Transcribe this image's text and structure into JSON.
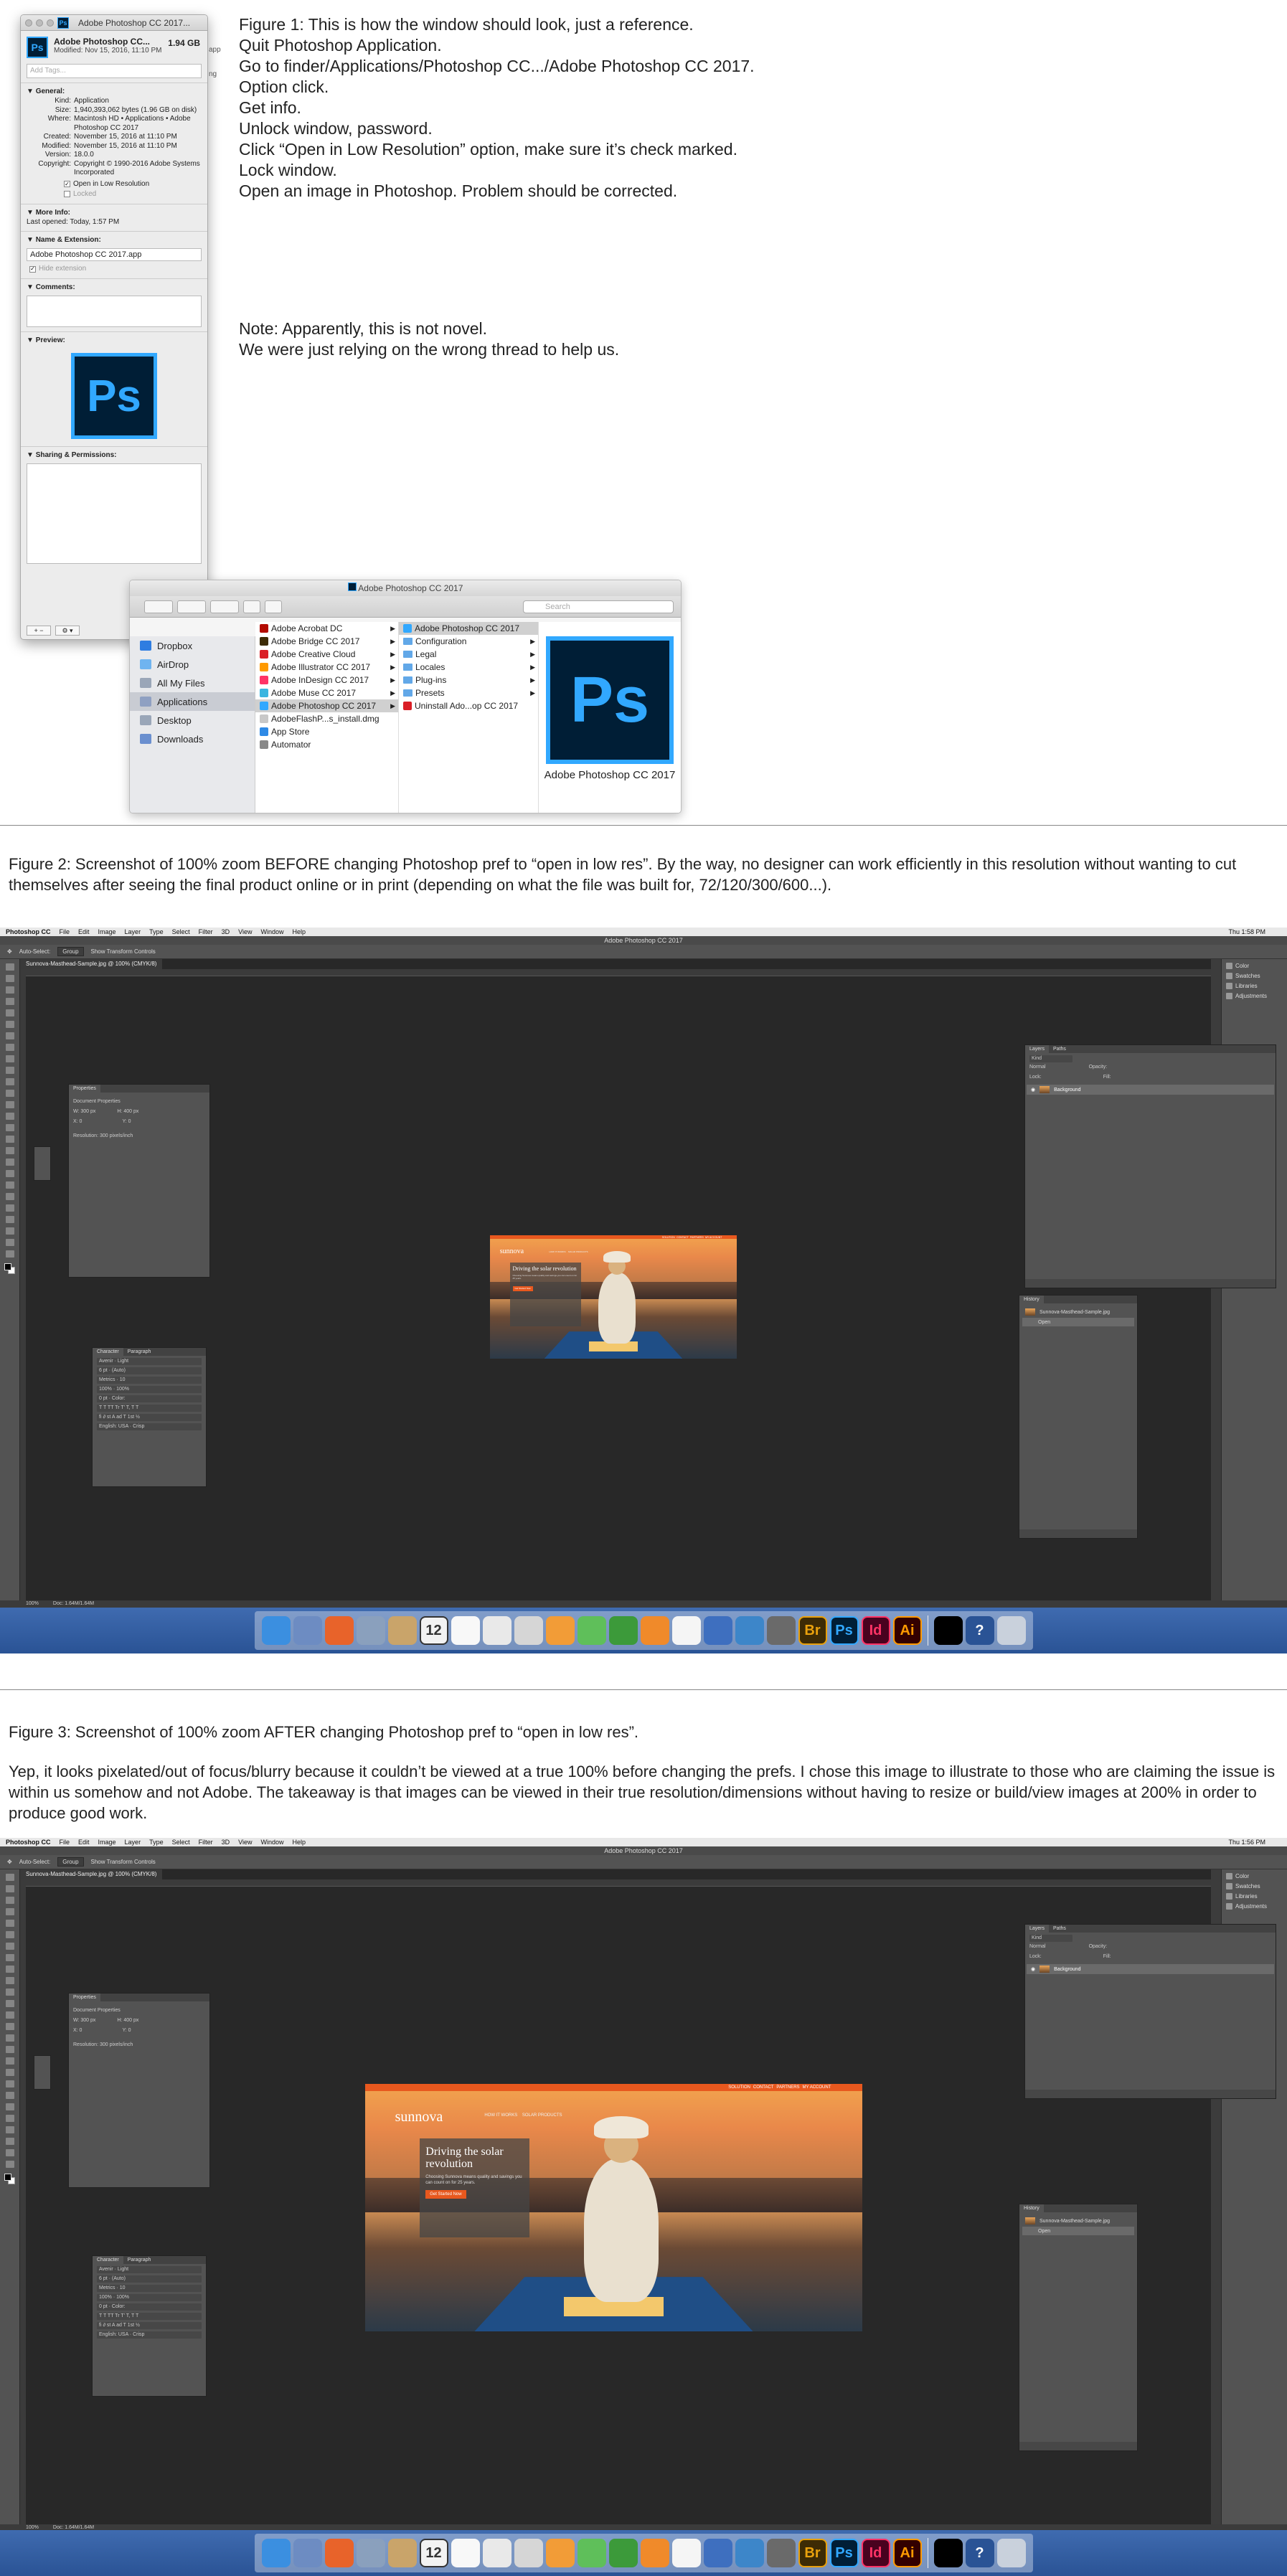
{
  "fig1": {
    "instructions": [
      "Figure 1: This is how the window should look, just a reference.",
      "Quit Photoshop Application.",
      "Go to finder/Applications/Photoshop CC.../Adobe Photoshop CC 2017.",
      "Option click.",
      "Get info.",
      "Unlock window, password.",
      "Click “Open in Low Resolution” option, make sure it’s check marked.",
      "Lock window.",
      "Open an image in Photoshop. Problem should be corrected."
    ],
    "note": [
      "Note: Apparently, this is not novel.",
      "We were just relying on the wrong thread to help us."
    ],
    "get_info": {
      "window_title": "Adobe Photoshop CC 2017...",
      "icon_letters": "Ps",
      "name": "Adobe Photoshop CC...",
      "size": "1.94 GB",
      "modified_header": "Modified: Nov 15, 2016, 11:10 PM",
      "tags_placeholder": "Add Tags...",
      "general_label": "General:",
      "rows": [
        {
          "k": "Kind:",
          "v": "Application"
        },
        {
          "k": "Size:",
          "v": "1,940,393,062 bytes (1.96 GB on disk)"
        },
        {
          "k": "Where:",
          "v": "Macintosh HD • Applications • Adobe Photoshop CC 2017"
        },
        {
          "k": "Created:",
          "v": "November 15, 2016 at 11:10 PM"
        },
        {
          "k": "Modified:",
          "v": "November 15, 2016 at 11:10 PM"
        },
        {
          "k": "Version:",
          "v": "18.0.0"
        },
        {
          "k": "Copyright:",
          "v": "Copyright © 1990-2016 Adobe Systems Incorporated"
        }
      ],
      "open_low_res_label": "Open in Low Resolution",
      "locked_label": "Locked",
      "more_info_label": "More Info:",
      "last_opened": "Last opened: Today, 1:57 PM",
      "name_ext_label": "Name & Extension:",
      "name_ext_value": "Adobe Photoshop CC 2017.app",
      "hide_ext_label": "Hide extension",
      "comments_label": "Comments:",
      "preview_label": "Preview:",
      "sharing_label": "Sharing & Permissions:",
      "partial_side_text": [
        "app",
        "ng"
      ]
    },
    "finder": {
      "title": "Adobe Photoshop CC 2017",
      "search_placeholder": "Search",
      "sidebar": [
        {
          "label": "Dropbox",
          "color": "#2f7de1"
        },
        {
          "label": "AirDrop",
          "color": "#6fb4f0"
        },
        {
          "label": "All My Files",
          "color": "#9aa6b8"
        },
        {
          "label": "Applications",
          "color": "#8fa0c2"
        },
        {
          "label": "Desktop",
          "color": "#9aa6b8"
        },
        {
          "label": "Downloads",
          "color": "#6a8fcf"
        }
      ],
      "col1": [
        "Adobe Acrobat DC",
        "Adobe Bridge CC 2017",
        "Adobe Creative Cloud",
        "Adobe Illustrator CC 2017",
        "Adobe InDesign CC 2017",
        "Adobe Muse CC 2017",
        "Adobe Photoshop CC 2017",
        "AdobeFlashP...s_install.dmg",
        "App Store",
        "Automator"
      ],
      "col2": [
        "Adobe Photoshop CC 2017",
        "Configuration",
        "Legal",
        "Locales",
        "Plug-ins",
        "Presets",
        "Uninstall Ado...op CC 2017"
      ],
      "preview_name": "Adobe Photoshop CC 2017"
    }
  },
  "fig2_caption": "Figure 2: Screenshot of 100% zoom BEFORE changing Photoshop pref to “open in low res”. By the way, no designer can work efficiently in this resolution without wanting to cut themselves after seeing the final product online or in print (depending on what the file was built for, 72/120/300/600...).",
  "fig3_caption_1": "Figure 3: Screenshot of 100% zoom AFTER changing Photoshop pref to “open in low res”.",
  "fig3_caption_2": "Yep, it looks pixelated/out of focus/blurry because it couldn’t be viewed at a true 100% before changing the prefs. I chose this image to illustrate to those who are claiming the issue is within us somehow and not Adobe. The takeaway is that images can be viewed in their true resolution/dimensions without having to resize or build/view images at 200% in order to produce good work.",
  "ps": {
    "menu": [
      "Photoshop CC",
      "File",
      "Edit",
      "Image",
      "Layer",
      "Type",
      "Select",
      "Filter",
      "3D",
      "View",
      "Window",
      "Help"
    ],
    "clock": "Thu 1:58 PM",
    "clock2": "Thu 1:56 PM",
    "app_title": "Adobe Photoshop CC 2017",
    "opt_autoselect": "Auto-Select:",
    "opt_group": "Group",
    "opt_transform": "Show Transform Controls",
    "doc_tab": "Sunnova-Masthead-Sample.jpg @ 100% (CMYK/8)",
    "right_strip": [
      "Color",
      "Swatches",
      "Libraries",
      "Adjustments"
    ],
    "properties": {
      "title": "Properties",
      "sub": "Document Properties",
      "w": "W: 300 px",
      "h": "H: 400 px",
      "x": "X: 0",
      "y": "Y: 0",
      "res": "Resolution: 300 pixels/inch"
    },
    "character": {
      "tabs": [
        "Character",
        "Paragraph"
      ],
      "rows": [
        "Avenir  ·  Light",
        "6 pt  ·  (Auto)",
        "Metrics  ·  10",
        "100%  ·  100%",
        "0 pt  ·  Color:",
        "T T TT Tr T' T, T T",
        "fi ∂ st A ad T 1st ½",
        "English: USA  ·  Crisp"
      ]
    },
    "layers": {
      "tabs": [
        "Layers",
        "Paths"
      ],
      "kind": "Kind",
      "normal": "Normal",
      "opacity": "Opacity:",
      "lock": "Lock:",
      "fill": "Fill:",
      "layer_name": "Background"
    },
    "history": {
      "title": "History",
      "doc": "Sunnova-Masthead-Sample.jpg",
      "open": "Open"
    },
    "status": [
      "100%",
      "Doc: 1.64M/1.64M"
    ],
    "site": {
      "nav": [
        "SOLUTION",
        "CONTACT",
        "PARTNERS",
        "MY ACCOUNT"
      ],
      "logo": "sunnova",
      "links": "HOW IT WORKS    SOLAR PRODUCTS",
      "headline": "Driving the solar revolution",
      "sub": "Choosing Sunnova means quality and savings you can count on for 25 years.",
      "cta": "Get Started Now"
    },
    "dock": [
      {
        "label": "",
        "color": "#3b8fe0"
      },
      {
        "label": "",
        "color": "#6d8cc2"
      },
      {
        "label": "",
        "color": "#e8632a"
      },
      {
        "label": "",
        "color": "#8aa0bd"
      },
      {
        "label": "",
        "color": "#c9a46a"
      },
      {
        "label": "12",
        "color": "#f2f2f2"
      },
      {
        "label": "",
        "color": "#f8f8f8"
      },
      {
        "label": "",
        "color": "#e9e9e9"
      },
      {
        "label": "",
        "color": "#d6d6d6"
      },
      {
        "label": "",
        "color": "#f29c37"
      },
      {
        "label": "",
        "color": "#5fbf5a"
      },
      {
        "label": "",
        "color": "#3c9a3a"
      },
      {
        "label": "",
        "color": "#f08a2a"
      },
      {
        "label": "",
        "color": "#f5f5f5"
      },
      {
        "label": "",
        "color": "#3e6fbf"
      },
      {
        "label": "",
        "color": "#3d86c9"
      },
      {
        "label": "",
        "color": "#6a6a6a"
      },
      {
        "label": "Br",
        "color": "#3d2b05"
      },
      {
        "label": "Ps",
        "color": "#001e36"
      },
      {
        "label": "Id",
        "color": "#49021f"
      },
      {
        "label": "Ai",
        "color": "#330000"
      },
      {
        "label": "",
        "color": "#000000"
      },
      {
        "label": "?",
        "color": "#2a5395"
      },
      {
        "label": "",
        "color": "#c9d1dc"
      }
    ],
    "dock_label_colors": {
      "Br": "#e9a10d",
      "Ps": "#31a8ff",
      "Id": "#ff3366",
      "Ai": "#ff9a00",
      "12": "#333333"
    }
  }
}
